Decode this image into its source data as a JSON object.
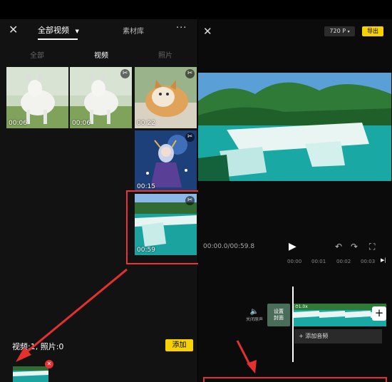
{
  "left": {
    "title": "全部视频",
    "library_tab": "素材库",
    "more": "···",
    "tabs": [
      "全部",
      "视频",
      "照片"
    ],
    "active_tab_index": 1,
    "thumbs": [
      {
        "duration": "00:06",
        "kind": "goat"
      },
      {
        "duration": "00:06",
        "kind": "goat"
      },
      {
        "duration": "00:22",
        "kind": "cat"
      },
      {
        "duration": "00:15",
        "kind": "anime"
      },
      {
        "duration": "00:59",
        "kind": "waterfall"
      }
    ],
    "selection_summary": "视频:1, 照片:0",
    "add_button": "添加"
  },
  "right": {
    "resolution": "720 P",
    "export_button": "导出",
    "time_display": "00:00.0/00:59.8",
    "ruler_ticks": [
      "00:00",
      "00:01",
      "00:02",
      "00:03"
    ],
    "mute_label": "关闭原声",
    "cover_label": "设置\n封面",
    "speed": "1.0x",
    "add_audio": "+ 添加音频"
  },
  "colors": {
    "accent": "#f5d200",
    "annotation": "#e53030"
  }
}
